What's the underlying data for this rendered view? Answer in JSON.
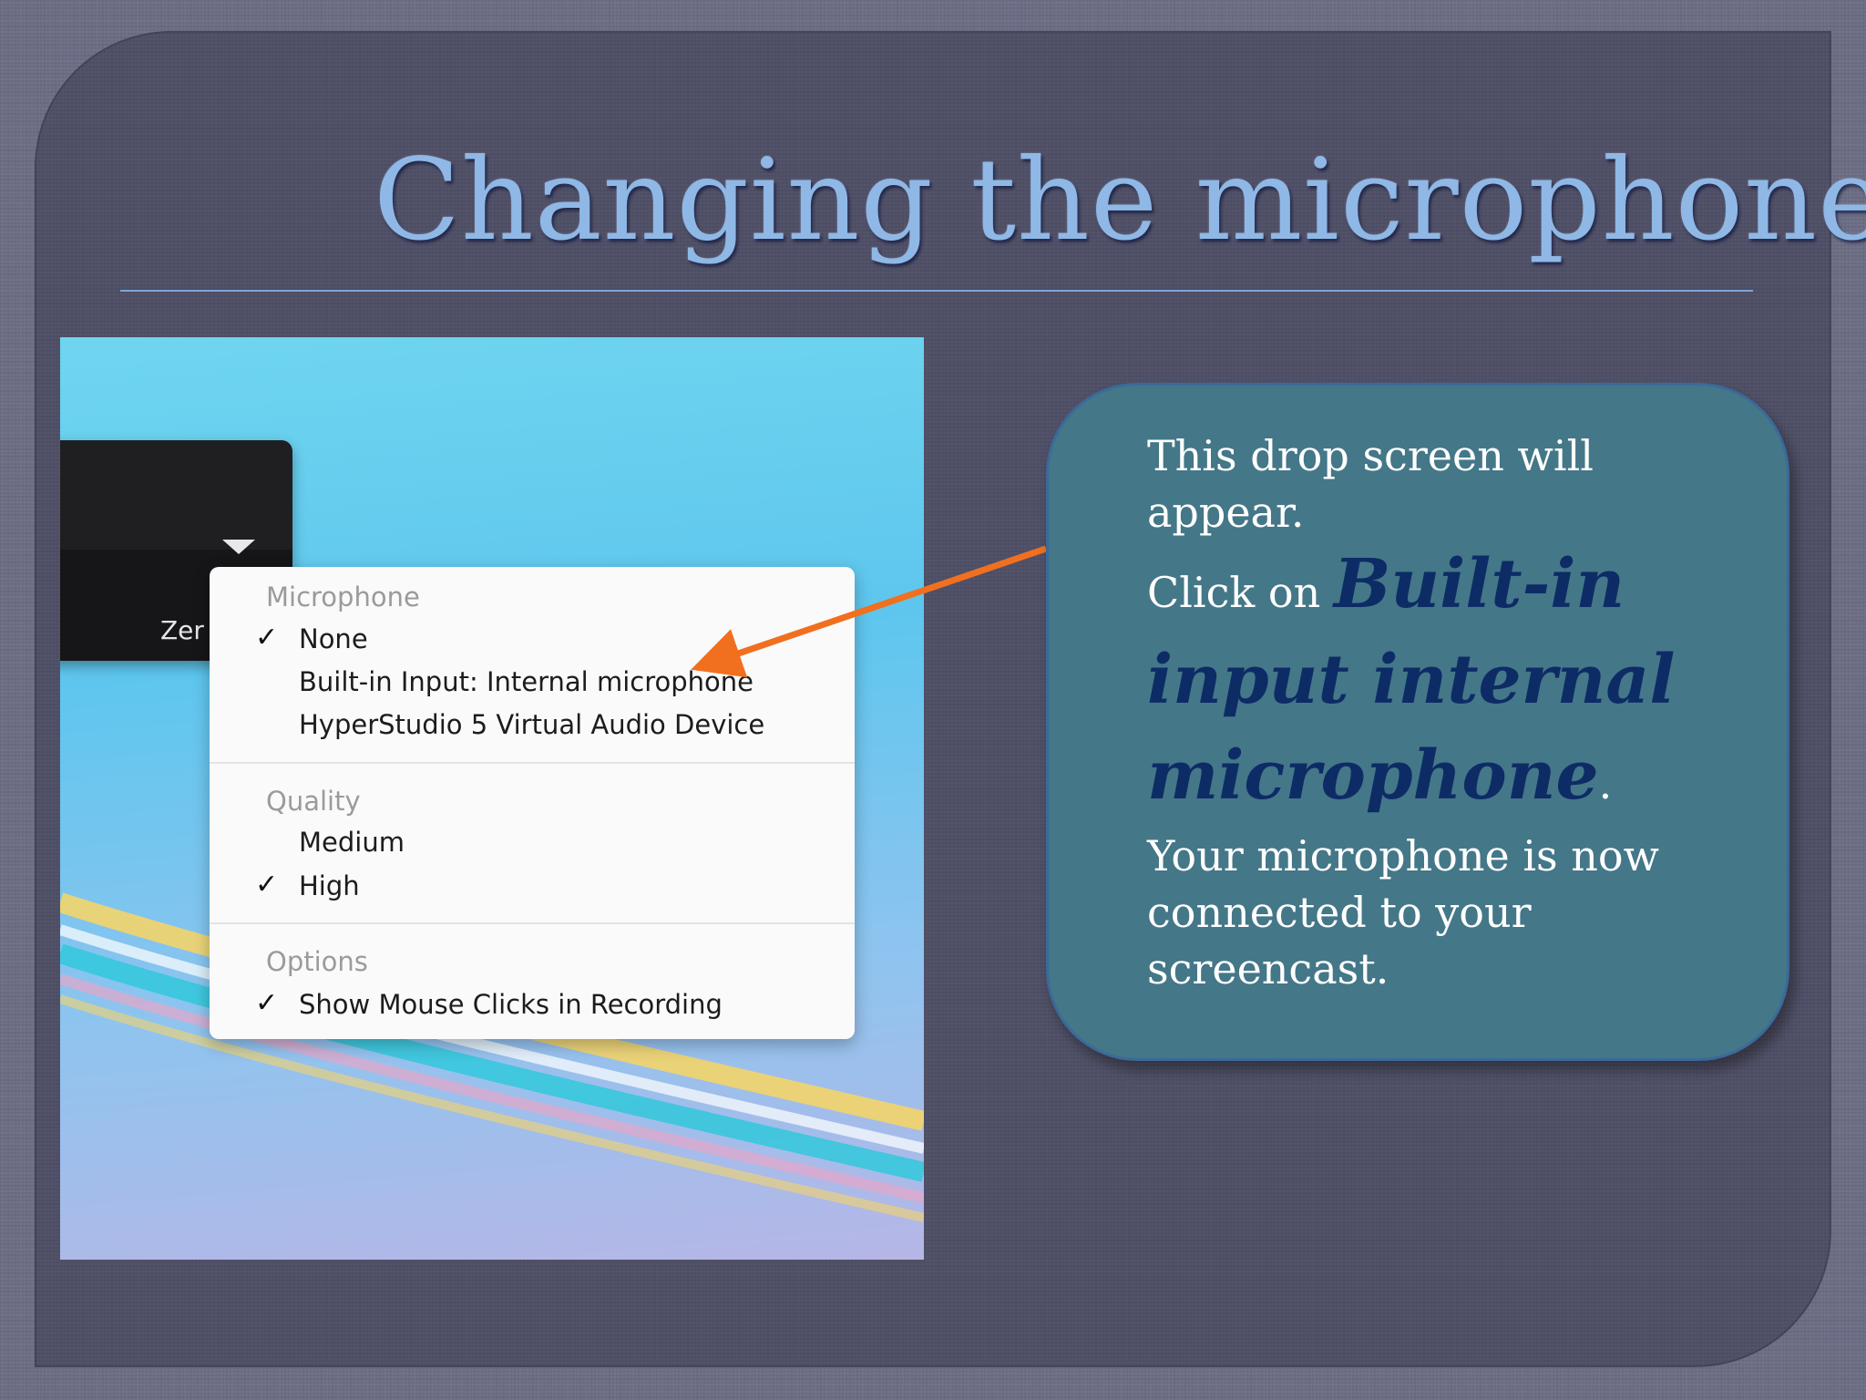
{
  "slide": {
    "title": "Changing the microphone"
  },
  "screenshot": {
    "panel_label": "Zer",
    "menu": {
      "microphone_header": "Microphone",
      "microphone_items": [
        {
          "label": "None",
          "checked": true
        },
        {
          "label": "Built-in Input: Internal microphone",
          "checked": false
        },
        {
          "label": "HyperStudio 5 Virtual Audio Device",
          "checked": false
        }
      ],
      "quality_header": "Quality",
      "quality_items": [
        {
          "label": "Medium",
          "checked": false
        },
        {
          "label": "High",
          "checked": true
        }
      ],
      "options_header": "Options",
      "options_items": [
        {
          "label": "Show Mouse Clicks in Recording",
          "checked": true
        }
      ],
      "check_glyph": "✓"
    }
  },
  "callout": {
    "line1": "This drop screen will appear.",
    "click_prefix": "Click on ",
    "click_emphasis": "Built-in input internal microphone",
    "click_suffix": ".",
    "line3": "Your microphone is now connected to your screencast."
  },
  "colors": {
    "title": "#8fb8e6",
    "callout_fill": "#447788",
    "callout_emphasis": "#0d2c66",
    "arrow": "#f07020"
  }
}
